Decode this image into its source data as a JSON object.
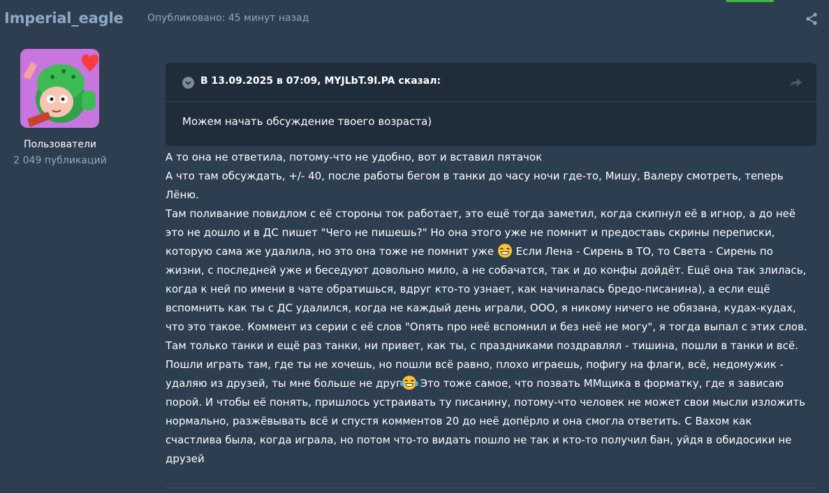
{
  "author": {
    "name": "Imperial_eagle",
    "group": "Пользователи",
    "posts": "2 049 публикаций"
  },
  "post_meta": {
    "published": "Опубликовано: 45 минут назад"
  },
  "icons": {
    "share": "share-icon",
    "toggle": "chevron-down-icon",
    "goto": "forward-arrow-icon"
  },
  "quote": {
    "header": "В 13.09.2025 в 07:09, MYJLbT.9I.PA сказал:",
    "text": "Можем начать обсуждение твоего возраста)"
  },
  "body": {
    "line1": "А то она не ответила, потому-что не удобно, вот и вставил пятачок",
    "line2": "А что там обсуждать, +/- 40, после работы бегом в танки до часу ночи где-то, Мишу, Валеру смотреть, теперь Лёню.",
    "para_a": "Там поливание повидлом с её стороны ток работает, это ещё тогда заметил, когда скипнул её в игнор, а до неё это не дошло и в ДС пишет \"Чего не пишешь?\" Но она этого уже не помнит и предоставь скрины переписки, которую сама же удалила, но это она тоже не помнит уже",
    "para_b": " Если Лена - Сирень в ТО, то Света - Сирень по жизни, с последней уже и беседуют довольно мило, а не собачатся, так и до конфы дойдёт. Ещё она так злилась, когда к ней по имени в чате обратишься, вдруг кто-то узнает, как начиналась бредо-писанина), а если ещё вспомнить как ты с ДС удалился, когда не каждый день играли, ООО, я никому ничего не обязана, кудах-кудах, что это такое. Коммент из серии с её слов \"Опять про неё вспомнил и без неё не могу\", я тогда выпал с этих слов. Там только танки и ещё раз танки, ни привет, как ты, с праздниками поздравлял - тишина, пошли в танки и всё. Пошли играть там, где ты не хочешь, но пошли всё равно, плохо играешь, пофигу на флаги, всё, недомужик - удаляю из друзей, ты мне больше не друг",
    "para_c": " Это тоже самое, что позвать ММщика в форматку, где я зависаю порой. И чтобы её понять, пришлось устраивать ту писанину, потому-что человек не может свои мысли изложить нормально, разжёвывать всё и спустя комментов 20 до неё допёрло и она смогла ответить. С Вахом как счастлива была, когда играла, но потом что-то видать пошло не так и кто-то получил бан, уйдя в обидосики не друзей"
  }
}
